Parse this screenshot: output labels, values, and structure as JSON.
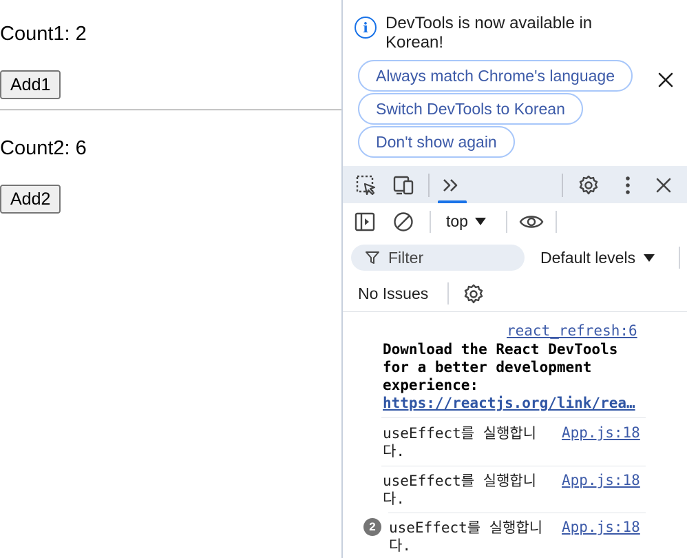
{
  "page": {
    "count1_label": "Count1: 2",
    "add1_label": "Add1",
    "count2_label": "Count2: 6",
    "add2_label": "Add2"
  },
  "devtools": {
    "infobar": {
      "message": "DevTools is now available in Korean!",
      "btn_match": "Always match Chrome's language",
      "btn_switch": "Switch DevTools to Korean",
      "btn_dont_show": "Don't show again"
    },
    "toolbar": {
      "icons": [
        "inspect-element-icon",
        "device-toolbar-icon",
        "more-tabs-icon",
        "settings-icon",
        "more-options-icon",
        "close-devtools-icon"
      ]
    },
    "console_toolbar": {
      "context": "top",
      "filter_placeholder": "Filter",
      "levels": "Default levels",
      "issues": "No Issues"
    },
    "console": {
      "messages": [
        {
          "source": "react_refresh:6",
          "text_lines": [
            "Download the React DevTools",
            "for a better development",
            "experience:"
          ],
          "link": "https://reactjs.org/link/rea…"
        },
        {
          "text": "useEffect를 실행합니다.",
          "source": "App.js:18"
        },
        {
          "text": "useEffect를 실행합니다.",
          "source": "App.js:18"
        },
        {
          "text": "useEffect를 실행합니다.",
          "source": "App.js:18",
          "repeat_count": "2"
        }
      ]
    },
    "colors": {
      "accent": "#1a73e8",
      "toolbar_bg": "#e8edf4",
      "link": "#3c5aa8"
    }
  }
}
